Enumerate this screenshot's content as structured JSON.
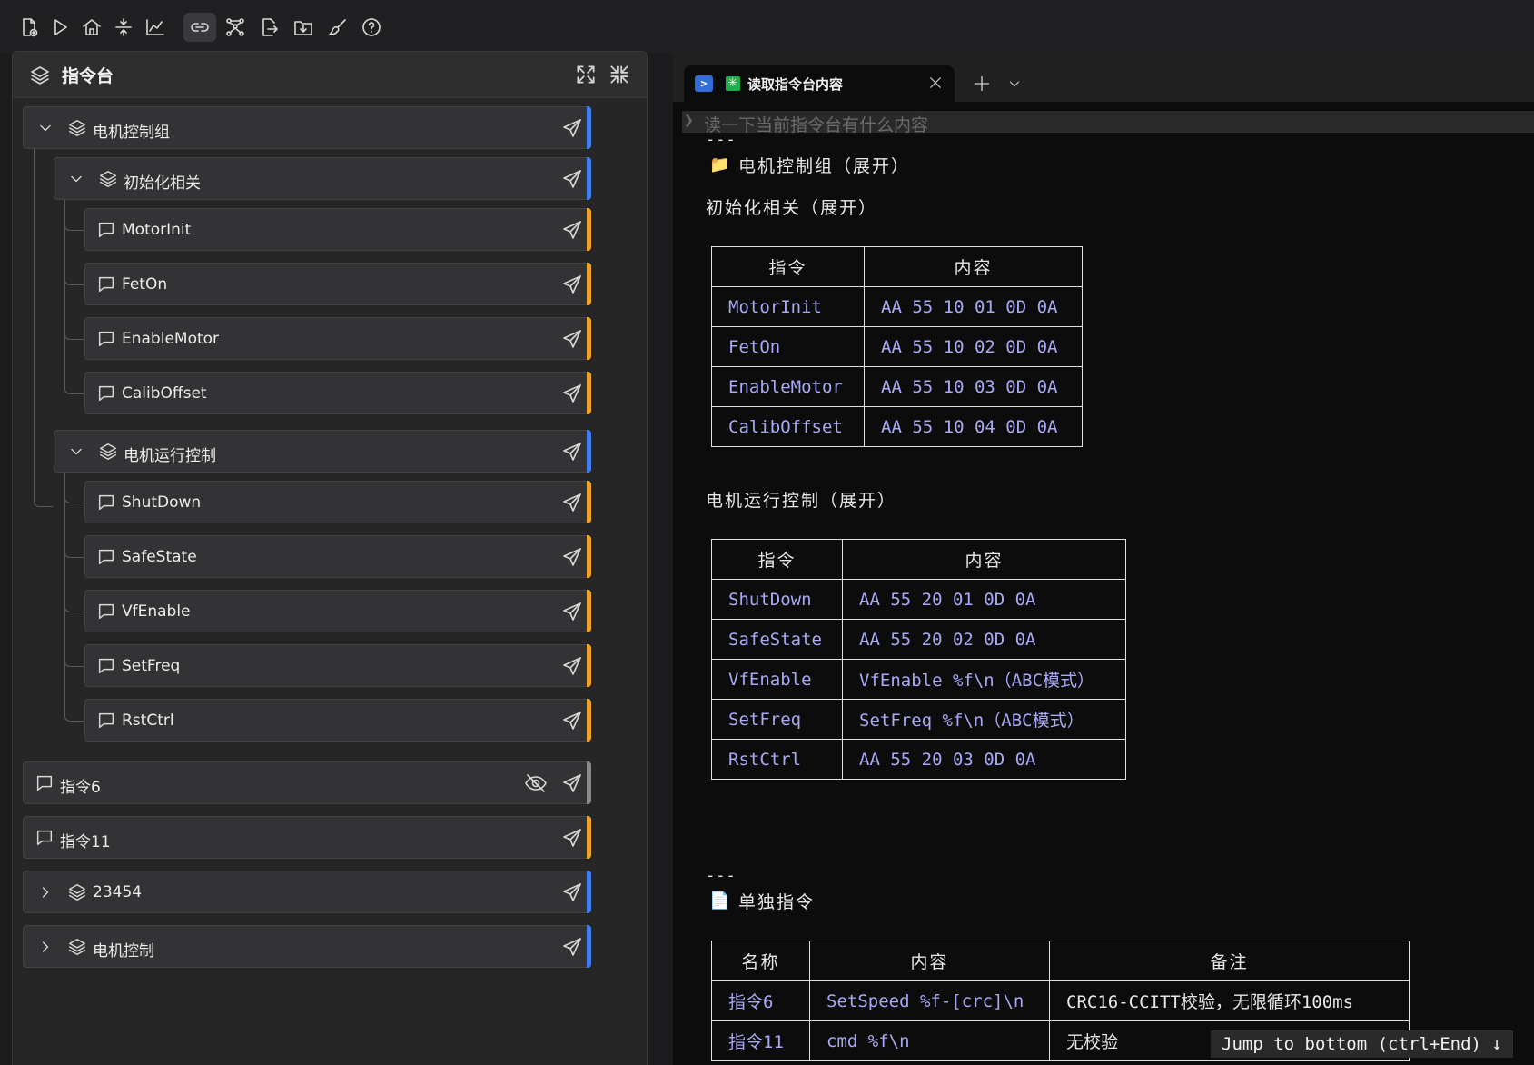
{
  "toolbar": {
    "buttons": [
      "new-file-icon",
      "run-icon",
      "home-icon",
      "collapse-icon",
      "chart-icon",
      "link-icon",
      "nodes-icon",
      "export-icon",
      "import-icon",
      "brush-icon",
      "help-icon"
    ],
    "active": "link-icon"
  },
  "panel": {
    "title": "指令台",
    "rows": [
      {
        "label": "电机控制组",
        "type": "group",
        "bar": "blue"
      },
      {
        "label": "初始化相关",
        "type": "group",
        "bar": "blue"
      },
      {
        "label": "MotorInit",
        "type": "command",
        "bar": "orange"
      },
      {
        "label": "FetOn",
        "type": "command",
        "bar": "orange"
      },
      {
        "label": "EnableMotor",
        "type": "command",
        "bar": "orange"
      },
      {
        "label": "CalibOffset",
        "type": "command",
        "bar": "orange"
      },
      {
        "label": "电机运行控制",
        "type": "group",
        "bar": "blue"
      },
      {
        "label": "ShutDown",
        "type": "command",
        "bar": "orange"
      },
      {
        "label": "SafeState",
        "type": "command",
        "bar": "orange"
      },
      {
        "label": "VfEnable",
        "type": "command",
        "bar": "orange"
      },
      {
        "label": "SetFreq",
        "type": "command",
        "bar": "orange"
      },
      {
        "label": "RstCtrl",
        "type": "command",
        "bar": "orange"
      },
      {
        "label": "指令6",
        "type": "command",
        "bar": "gray",
        "hidden": true
      },
      {
        "label": "指令11",
        "type": "command",
        "bar": "orange"
      },
      {
        "label": "23454",
        "type": "group",
        "bar": "blue",
        "collapsed": true
      },
      {
        "label": "电机控制",
        "type": "group",
        "bar": "blue",
        "collapsed": true
      }
    ]
  },
  "colors": {
    "blue": "#3f7ef0",
    "orange": "#f0a429",
    "gray": "#8a8a8a",
    "link": "#a9a9f5"
  },
  "terminal": {
    "tab_title": "读取指令台内容",
    "tab_ps_icon": "ps-icon",
    "tab_star": "✳",
    "prompt": "❯",
    "command": "读一下当前指令台有什么内容",
    "rule1": "---",
    "group_heading": "电机控制组（展开）",
    "sub1_heading": "初始化相关（展开）",
    "table1": {
      "headers": [
        "指令",
        "内容"
      ],
      "rows": [
        [
          "MotorInit",
          "AA 55 10 01 0D 0A"
        ],
        [
          "FetOn",
          "AA 55 10 02 0D 0A"
        ],
        [
          "EnableMotor",
          "AA 55 10 03 0D 0A"
        ],
        [
          "CalibOffset",
          "AA 55 10 04 0D 0A"
        ]
      ]
    },
    "sub2_heading": "电机运行控制（展开）",
    "table2": {
      "headers": [
        "指令",
        "内容"
      ],
      "rows": [
        [
          "ShutDown",
          "AA 55 20 01 0D 0A"
        ],
        [
          "SafeState",
          "AA 55 20 02 0D 0A"
        ],
        [
          "VfEnable",
          "VfEnable %f\\n（ABC模式）"
        ],
        [
          "SetFreq",
          "SetFreq %f\\n（ABC模式）"
        ],
        [
          "RstCtrl",
          "AA 55 20 03 0D 0A"
        ]
      ]
    },
    "rule2": "---",
    "single_heading": "单独指令",
    "table3": {
      "headers": [
        "名称",
        "内容",
        "备注"
      ],
      "rows": [
        [
          "指令6",
          "SetSpeed %f-[crc]\\n",
          "CRC16-CCITT校验，无限循环100ms"
        ],
        [
          "指令11",
          "cmd %f\\n",
          "无校验"
        ]
      ]
    },
    "jump_label": "Jump to bottom (ctrl+End) ↓"
  }
}
